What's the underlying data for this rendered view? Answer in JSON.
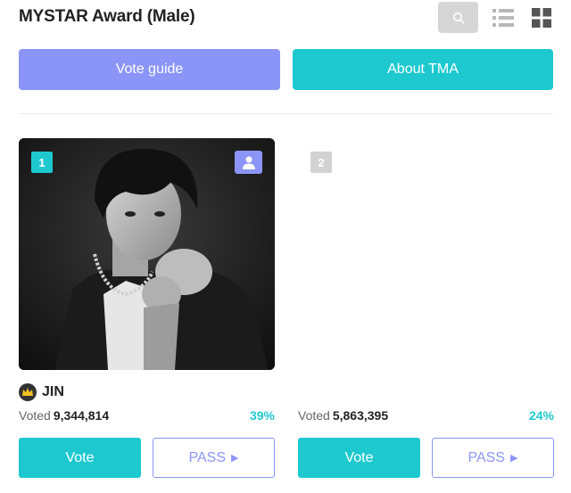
{
  "header": {
    "title": "MYSTAR Award (Male)",
    "search_icon": "search-icon",
    "list_icon": "list-view-icon",
    "grid_icon": "grid-view-icon"
  },
  "buttons": {
    "vote_guide": "Vote guide",
    "about": "About TMA"
  },
  "colors": {
    "accent_teal": "#1ec8cf",
    "accent_purple": "#8b95f7"
  },
  "candidates": [
    {
      "rank": "1",
      "name": "JIN",
      "voted_label": "Voted",
      "votes": "9,344,814",
      "percent": "39%",
      "vote_label": "Vote",
      "pass_label": "PASS",
      "pass_icon": "play-arrow-icon",
      "crown_icon": "crown-icon",
      "profile_icon": "person-icon"
    },
    {
      "rank": "2",
      "name": "",
      "voted_label": "Voted",
      "votes": "5,863,395",
      "percent": "24%",
      "vote_label": "Vote",
      "pass_label": "PASS",
      "pass_icon": "play-arrow-icon"
    }
  ]
}
